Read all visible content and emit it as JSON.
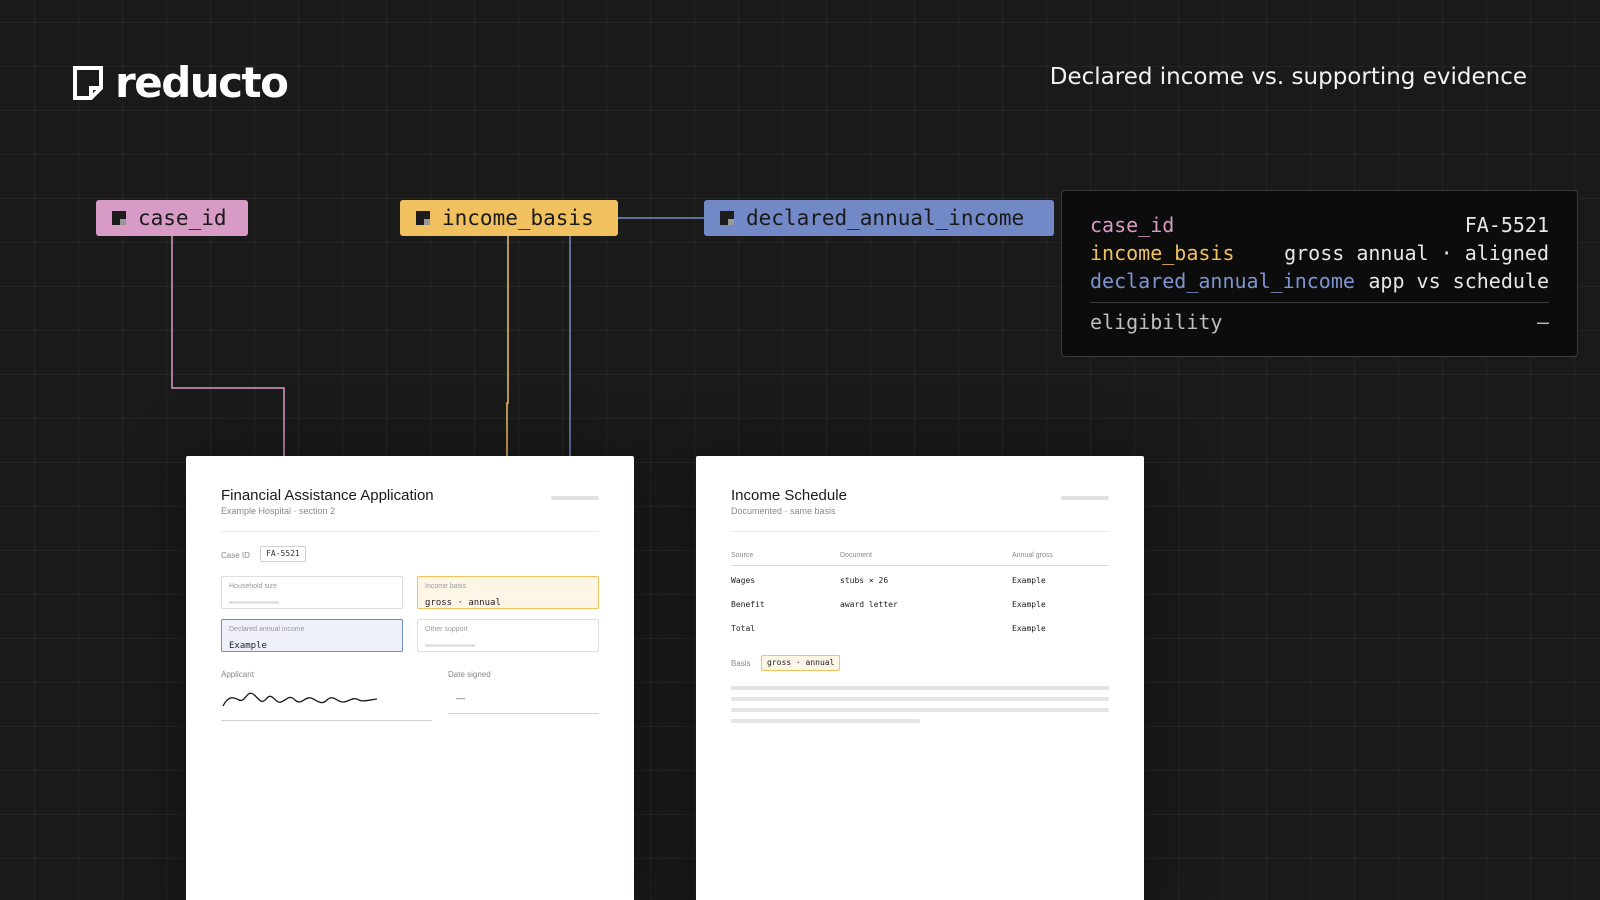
{
  "brand": {
    "name": "reducto"
  },
  "header": {
    "title": "Declared income vs. supporting evidence"
  },
  "chips": [
    {
      "key": "case_id",
      "color": "#d79bc6"
    },
    {
      "key": "income_basis",
      "color": "#f1c15f"
    },
    {
      "key": "declared_annual_income",
      "color": "#7389c7"
    }
  ],
  "result": {
    "rows": [
      {
        "key": "case_id",
        "value": "FA-5521"
      },
      {
        "key": "income_basis",
        "value": "gross annual · aligned"
      },
      {
        "key": "declared_annual_income",
        "value": "app vs schedule"
      }
    ],
    "eligibility": {
      "key": "eligibility",
      "value": "—"
    }
  },
  "application": {
    "title": "Financial Assistance Application",
    "subtitle": "Example Hospital · section 2",
    "case_label": "Case ID",
    "case_value": "FA-5521",
    "fields": {
      "household_label": "Household size",
      "basis_label": "Income basis",
      "basis_value": "gross · annual",
      "declared_label": "Declared annual income",
      "declared_value": "Example",
      "other_label": "Other support"
    },
    "applicant_label": "Applicant",
    "date_label": "Date signed",
    "date_value": "—"
  },
  "schedule": {
    "title": "Income Schedule",
    "subtitle": "Documented · same basis",
    "columns": [
      "Source",
      "Document",
      "Annual gross"
    ],
    "rows": [
      [
        "Wages",
        "stubs × 26",
        "Example"
      ],
      [
        "Benefit",
        "award letter",
        "Example"
      ],
      [
        "Total",
        "",
        "Example"
      ]
    ],
    "basis_label": "Basis",
    "basis_value": "gross · annual"
  }
}
